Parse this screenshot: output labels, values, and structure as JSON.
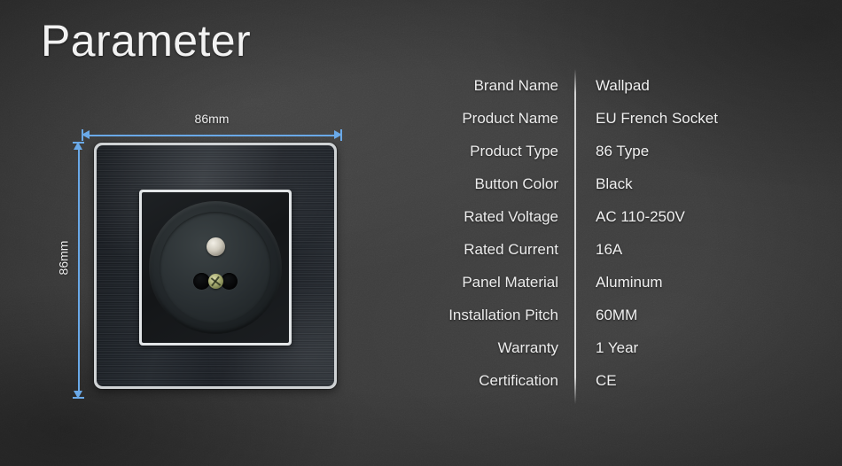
{
  "page": {
    "title": "Parameter",
    "background_color": "#3b3b3b"
  },
  "product_image": {
    "name": "eu-french-socket-panel",
    "accent_color": "#6aa9e8",
    "dimensions": {
      "width_label": "86mm",
      "height_label": "86mm"
    },
    "parts": {
      "earth_pin": "earth-pin",
      "left_hole": "socket-hole-left",
      "right_hole": "socket-hole-right",
      "center_screw": "center-screw"
    }
  },
  "spec_table": {
    "rows": [
      {
        "label": "Brand Name",
        "value": "Wallpad"
      },
      {
        "label": "Product Name",
        "value": "EU French Socket"
      },
      {
        "label": "Product Type",
        "value": "86 Type"
      },
      {
        "label": "Button Color",
        "value": "Black"
      },
      {
        "label": "Rated Voltage",
        "value": "AC 110-250V"
      },
      {
        "label": "Rated Current",
        "value": "16A"
      },
      {
        "label": "Panel Material",
        "value": "Aluminum"
      },
      {
        "label": "Installation Pitch",
        "value": "60MM"
      },
      {
        "label": "Warranty",
        "value": "1 Year"
      },
      {
        "label": "Certification",
        "value": "CE"
      }
    ]
  }
}
